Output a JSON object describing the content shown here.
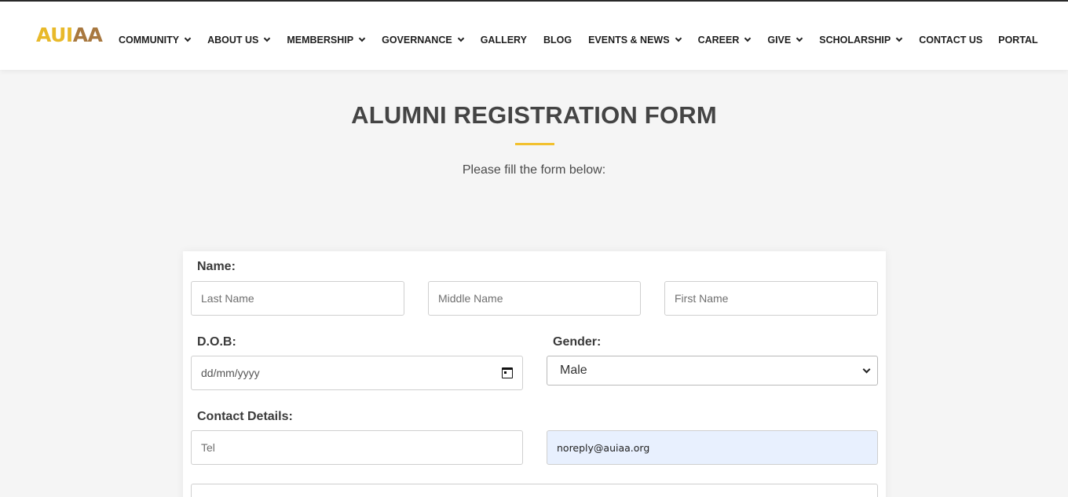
{
  "brand": {
    "logo_part1": "AUI",
    "logo_part2": "AA",
    "color_primary": "#e8b92a",
    "color_secondary": "#a8783f"
  },
  "nav": {
    "items": [
      {
        "label": "COMMUNITY",
        "dropdown": true
      },
      {
        "label": "ABOUT US",
        "dropdown": true
      },
      {
        "label": "MEMBERSHIP",
        "dropdown": true
      },
      {
        "label": "GOVERNANCE",
        "dropdown": true
      },
      {
        "label": "GALLERY",
        "dropdown": false
      },
      {
        "label": "BLOG",
        "dropdown": false
      },
      {
        "label": "EVENTS & NEWS",
        "dropdown": true
      },
      {
        "label": "CAREER",
        "dropdown": true
      },
      {
        "label": "GIVE",
        "dropdown": true
      },
      {
        "label": "SCHOLARSHIP",
        "dropdown": true
      },
      {
        "label": "CONTACT US",
        "dropdown": false
      },
      {
        "label": "PORTAL",
        "dropdown": false
      }
    ]
  },
  "page": {
    "title": "ALUMNI REGISTRATION FORM",
    "subtitle": "Please fill the form below:",
    "accent": "#f2c12e"
  },
  "form": {
    "name_label": "Name:",
    "last_name_placeholder": "Last Name",
    "middle_name_placeholder": "Middle Name",
    "first_name_placeholder": "First Name",
    "dob_label": "D.O.B:",
    "dob_placeholder": "dd/mm/yyyy",
    "gender_label": "Gender:",
    "gender_value": "Male",
    "contact_label": "Contact Details:",
    "tel_placeholder": "Tel",
    "email_value": "noreply@auiaa.org"
  }
}
